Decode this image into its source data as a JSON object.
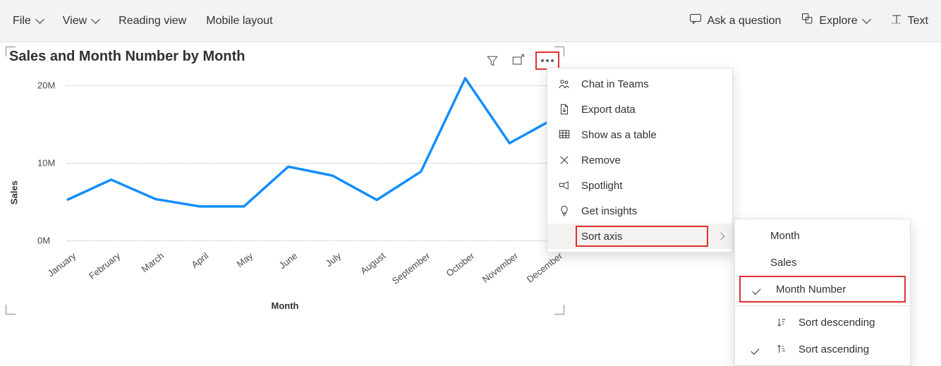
{
  "toolbar": {
    "file": "File",
    "view": "View",
    "reading_view": "Reading view",
    "mobile_layout": "Mobile layout",
    "ask_question": "Ask a question",
    "explore": "Explore",
    "text": "Text"
  },
  "chart": {
    "title": "Sales and Month Number by Month",
    "ylabel": "Sales",
    "xlabel": "Month"
  },
  "chart_data": {
    "type": "line",
    "title": "Sales and Month Number by Month",
    "xlabel": "Month",
    "ylabel": "Sales",
    "ylim": [
      0,
      20000000
    ],
    "yticks": [
      "0M",
      "10M",
      "20M"
    ],
    "categories": [
      "January",
      "February",
      "March",
      "April",
      "May",
      "June",
      "July",
      "August",
      "September",
      "October",
      "November",
      "December"
    ],
    "values": [
      5000000,
      7500000,
      5100000,
      4200000,
      4200000,
      9100000,
      8000000,
      5000000,
      8500000,
      20000000,
      12000000,
      15000000
    ]
  },
  "visual_toolbar": {
    "filter": "filter-icon",
    "focus": "focus-mode-icon",
    "more": "more-icon"
  },
  "context_menu": {
    "items": [
      {
        "label": "Chat in Teams",
        "icon": "teams-icon"
      },
      {
        "label": "Export data",
        "icon": "export-icon"
      },
      {
        "label": "Show as a table",
        "icon": "table-icon"
      },
      {
        "label": "Remove",
        "icon": "close-icon"
      },
      {
        "label": "Spotlight",
        "icon": "spotlight-icon"
      },
      {
        "label": "Get insights",
        "icon": "lightbulb-icon"
      },
      {
        "label": "Sort axis",
        "icon": "",
        "has_submenu": true,
        "hover": true
      }
    ]
  },
  "submenu": {
    "options": [
      {
        "label": "Month",
        "checked": false
      },
      {
        "label": "Sales",
        "checked": false
      },
      {
        "label": "Month Number",
        "checked": true,
        "highlight": true
      }
    ],
    "sort_desc": "Sort descending",
    "sort_asc": "Sort ascending"
  }
}
